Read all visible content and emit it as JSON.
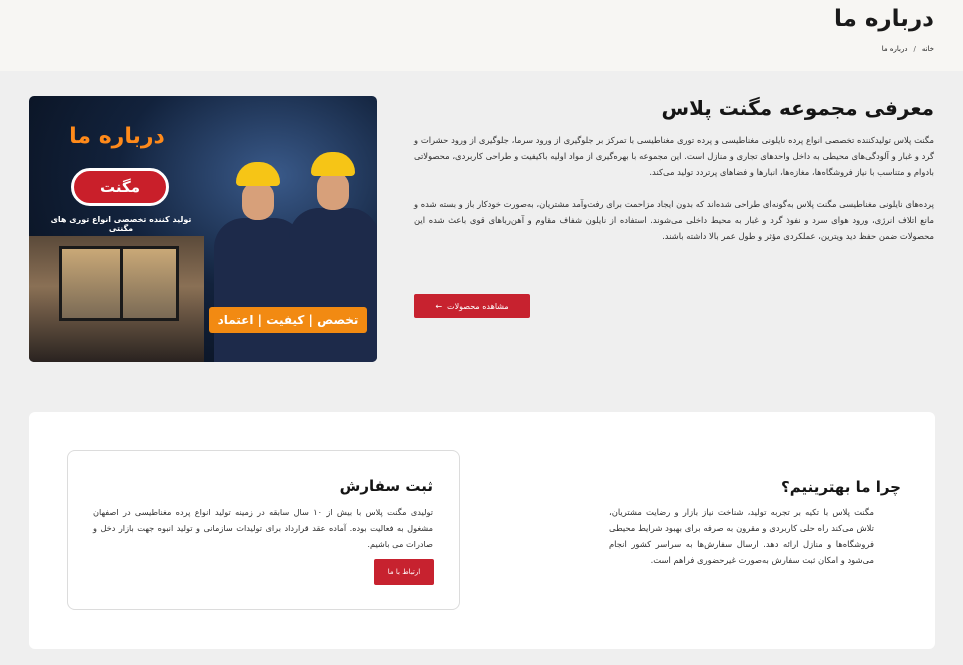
{
  "header": {
    "title": "درباره ما",
    "breadcrumb": [
      "خانه",
      "درباره ما"
    ],
    "separator": "/"
  },
  "intro": {
    "title": "معرفی مجموعه مگنت پلاس",
    "paragraph1": "مگنت پلاس تولیدکننده تخصصی انواع پرده نایلونی مغناطیسی و پرده توری مغناطیسی با تمرکز بر جلوگیری از ورود سرما، جلوگیری از ورود حشرات و گرد و غبار و آلودگی‌های محیطی به داخل واحدهای تجاری و منازل است. این مجموعه با بهره‌گیری از مواد اولیه باکیفیت و طراحی کاربردی، محصولاتی بادوام و متناسب با نیاز فروشگاه‌ها، مغازه‌ها، انبارها و فضاهای پرتردد تولید می‌کند.",
    "paragraph2": "پرده‌های نایلونی مغناطیسی مگنت پلاس به‌گونه‌ای طراحی شده‌اند که بدون ایجاد مزاحمت برای رفت‌وآمد مشتریان، به‌صورت خودکار باز و بسته شده و مانع اتلاف انرژی، ورود هوای سرد و نفوذ گرد و غبار به محیط داخلی می‌شوند. استفاده از نایلون شفاف مقاوم و آهن‌رباهای قوی باعث شده این محصولات ضمن حفظ دید ویترین، عملکردی مؤثر و طول عمر بالا داشته باشند.",
    "button_label": "مشاهده محصولات",
    "button_icon": "←"
  },
  "banner": {
    "title": "درباره ما",
    "logo_text": "مگنت",
    "subtitle": "تولید کننده تخصصی انواع توری های مگنتی",
    "slogan": "تخصص | کیفیت | اعتماد"
  },
  "why": {
    "title": "چرا ما بهترینیم؟",
    "text": "مگنت پلاس با تکیه بر تجربه تولید، شناخت نیاز بازار و رضایت مشتریان، تلاش می‌کند راه حلی کاربردی و مقرون به صرفه برای بهبود شرایط محیطی فروشگاه‌ها و منازل ارائه دهد. ارسال سفارش‌ها به سراسر کشور انجام می‌شود و امکان ثبت سفارش به‌صورت غیرحضوری فراهم است."
  },
  "order": {
    "title": "ثبت سفارش",
    "text": "تولیدی مگنت پلاس با بیش از ۱۰ سال سابقه در زمینه تولید انواع پرده مغناطیسی در اصفهان مشغول به فعالیت بوده. آماده عقد قرارداد برای تولیدات سازمانی و تولید انبوه جهت بازار دخل و صادرات می باشیم.",
    "button_label": "ارتباط با ما"
  },
  "colors": {
    "accent": "#c7222f",
    "orange": "#f28a12"
  }
}
